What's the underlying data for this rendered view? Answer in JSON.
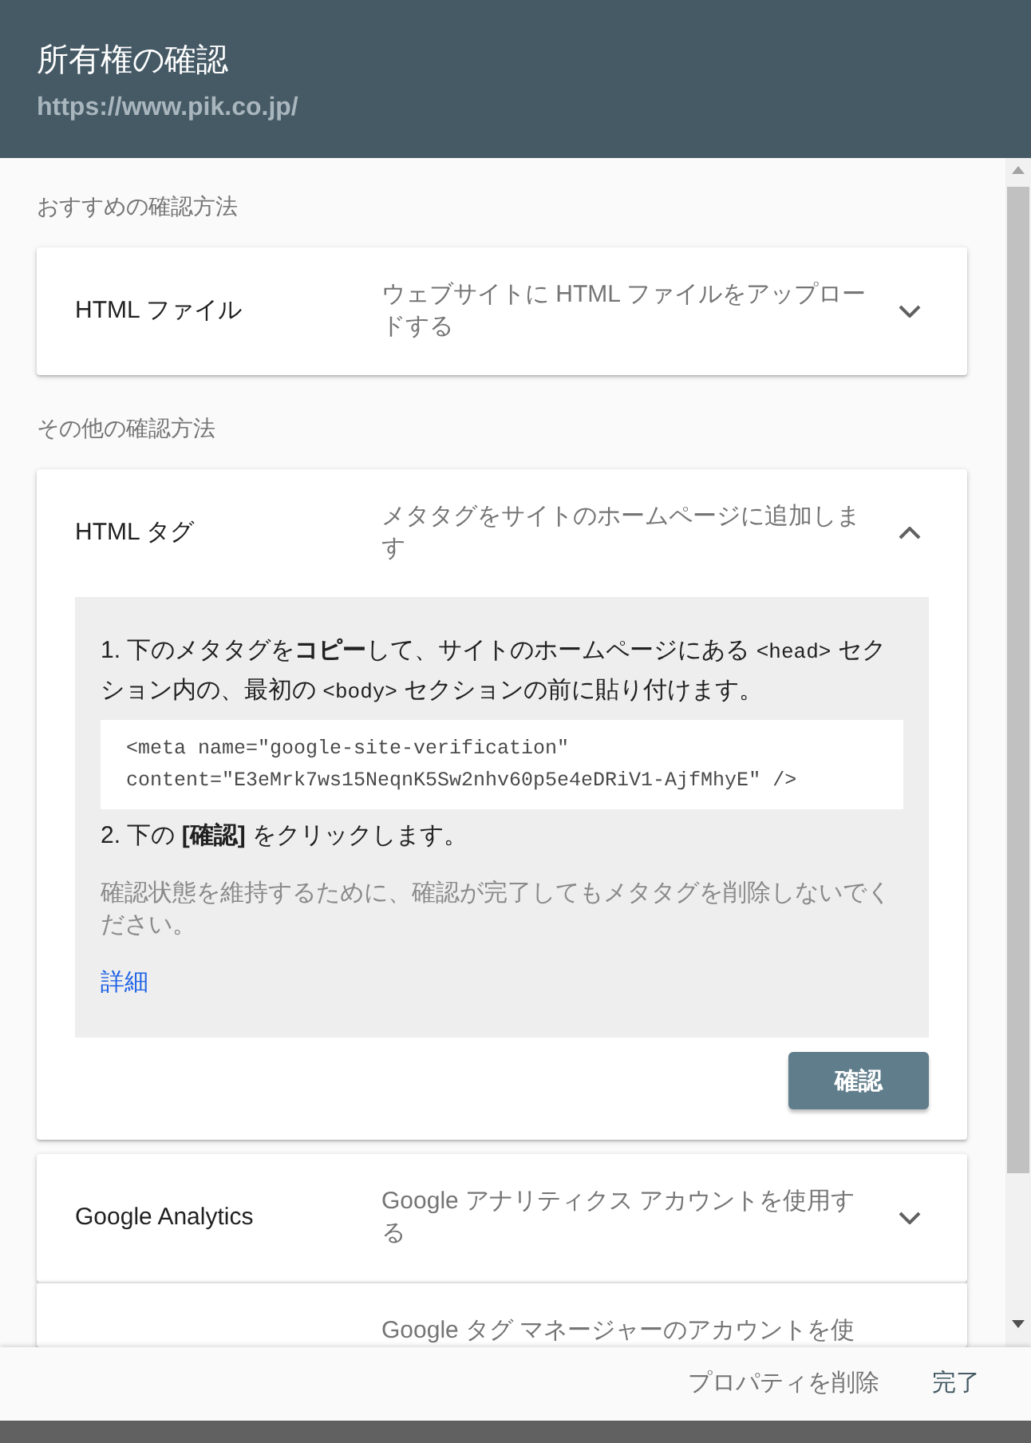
{
  "header": {
    "title": "所有権の確認",
    "url": "https://www.pik.co.jp/"
  },
  "sections": [
    {
      "label": "おすすめの確認方法",
      "methods": [
        {
          "title": "HTML ファイル",
          "description": "ウェブサイトに HTML ファイルをアップロードする",
          "expanded": false
        }
      ]
    },
    {
      "label": "その他の確認方法",
      "methods": [
        {
          "title": "HTML タグ",
          "description": "メタタグをサイトのホームページに追加します",
          "expanded": true,
          "instructions": [
            {
              "kind": "step",
              "segments": [
                {
                  "kind": "text",
                  "text": "1. 下のメタタグを**コピー**して、サイトのホームページにある "
                },
                {
                  "kind": "code",
                  "text": "<head>"
                },
                {
                  "kind": "text",
                  "text": " セクション内の、最初の "
                },
                {
                  "kind": "code",
                  "text": "<body>"
                },
                {
                  "kind": "text",
                  "text": " セクションの前に貼り付けます。"
                }
              ]
            },
            {
              "kind": "code",
              "text": "<meta name=\"google-site-verification\" content=\"E3eMrk7ws15NeqnK5Sw2nhv60p5e4eDRiV1-AjfMhyE\" />"
            },
            {
              "kind": "step",
              "segments": [
                {
                  "kind": "text",
                  "text": "2. 下の **[確認]** をクリックします。"
                }
              ]
            },
            {
              "kind": "note",
              "text": "確認状態を維持するために、確認が完了してもメタタグを削除しないでください。"
            },
            {
              "kind": "link",
              "text": "詳細"
            }
          ],
          "action": "確認"
        },
        {
          "title": "Google Analytics",
          "description": "Google アナリティクス アカウントを使用する",
          "expanded": false
        },
        {
          "description": "Google タグ マネージャーのアカウントを使"
        }
      ]
    }
  ],
  "footer": {
    "buttons": [
      {
        "label": "プロパティを削除",
        "kind": "secondary"
      },
      {
        "label": "完了",
        "kind": "primary"
      }
    ]
  }
}
